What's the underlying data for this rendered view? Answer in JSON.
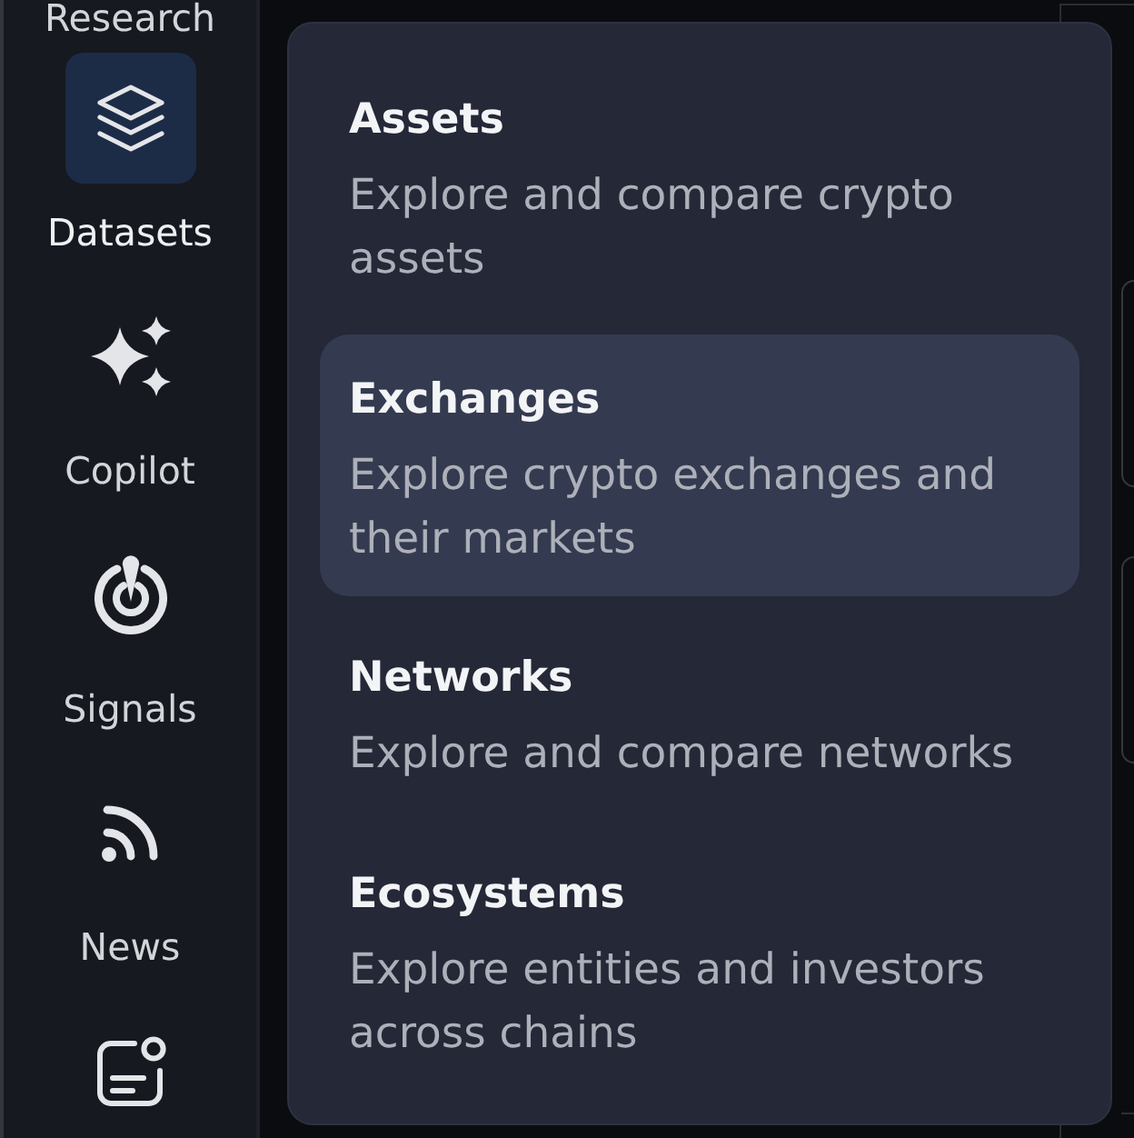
{
  "sidebar": {
    "nav_items": [
      {
        "label": "Research",
        "selected": false
      },
      {
        "label": "Datasets",
        "selected": true
      },
      {
        "label": "Copilot",
        "selected": false
      },
      {
        "label": "Signals",
        "selected": false
      },
      {
        "label": "News",
        "selected": false
      },
      {
        "selected": false
      }
    ]
  },
  "datasets_menu": {
    "items": [
      {
        "title": "Assets",
        "description": "Explore and compare crypto assets",
        "selected": false
      },
      {
        "title": "Exchanges",
        "description": "Explore crypto exchanges and their markets",
        "selected": true
      },
      {
        "title": "Networks",
        "description": "Explore and compare networks",
        "selected": false
      },
      {
        "title": "Ecosystems",
        "description": "Explore entities and investors across chains",
        "selected": false
      }
    ]
  }
}
